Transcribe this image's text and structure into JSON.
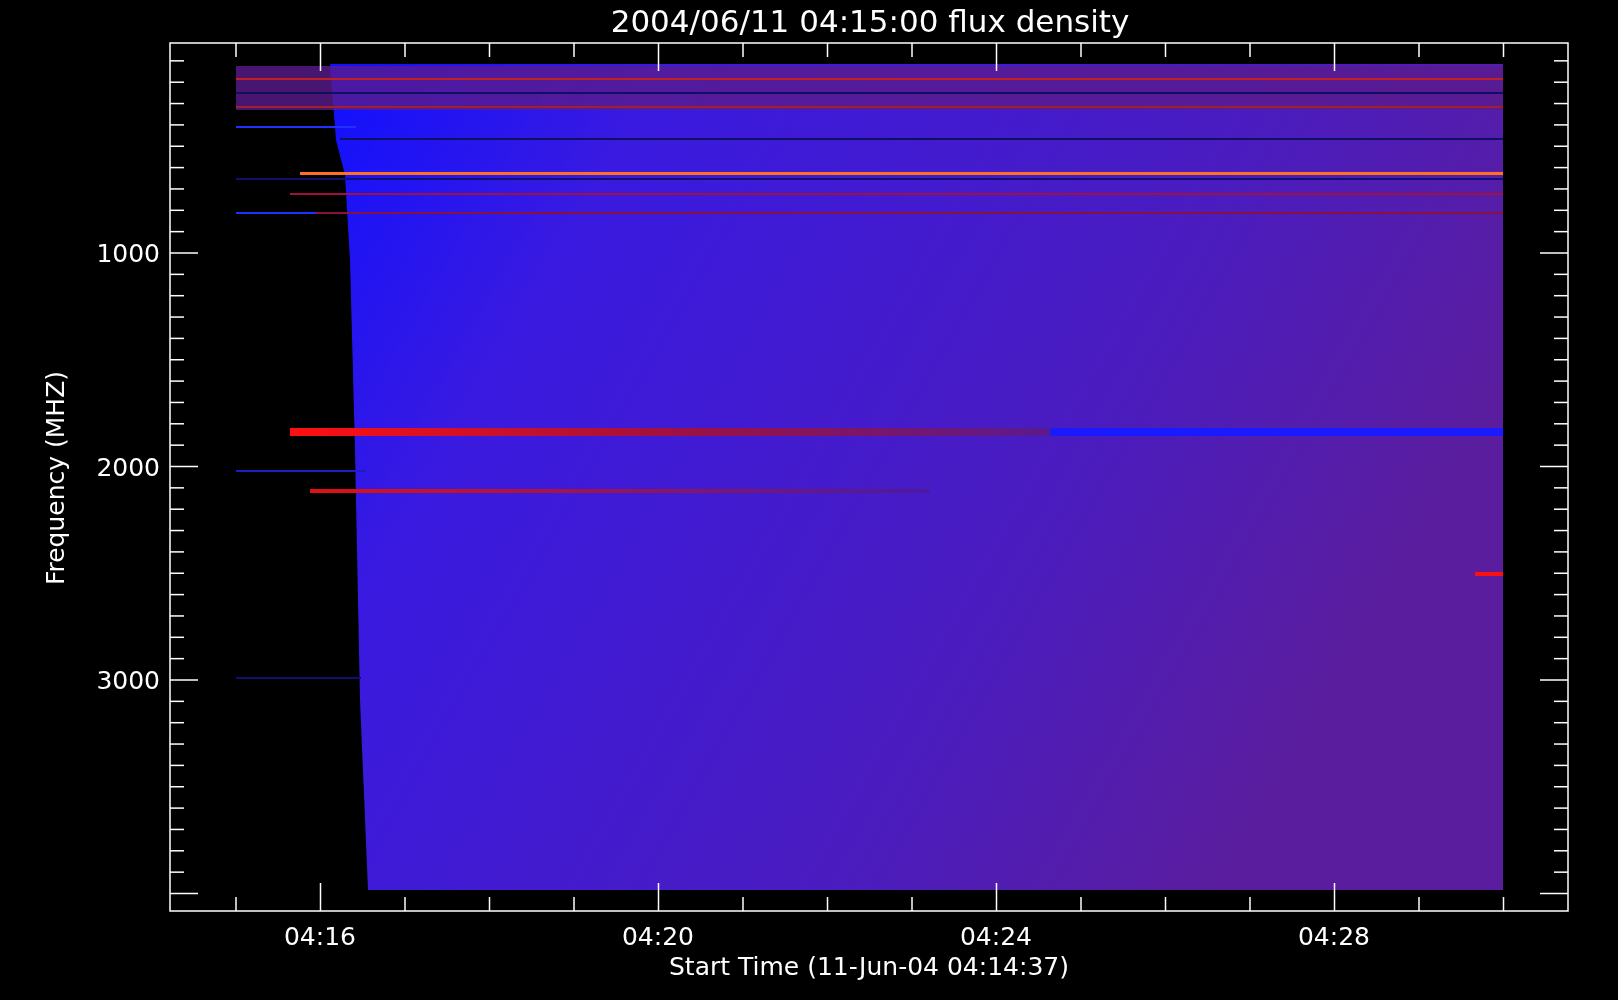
{
  "plot": {
    "title": "2004/06/11 04:15:00 flux density",
    "y_axis": {
      "label": "Frequency (MHZ)",
      "ticks": [
        "1000",
        "2000",
        "3000"
      ]
    },
    "x_axis": {
      "label": "Start Time (11-Jun-04 04:14:37)",
      "ticks": [
        "04:16",
        "04:20",
        "04:24",
        "04:28"
      ]
    }
  }
}
